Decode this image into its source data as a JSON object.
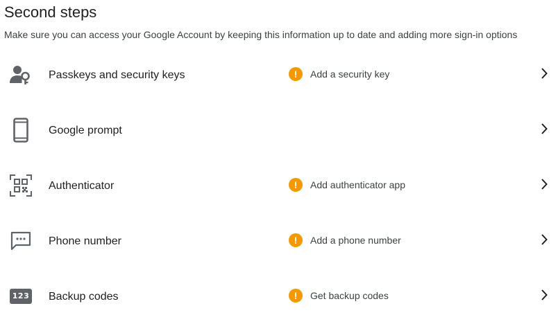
{
  "section": {
    "title": "Second steps",
    "subtitle": "Make sure you can access your Google Account by keeping this information up to date and adding more sign-in options"
  },
  "colors": {
    "warning": "#f29900",
    "icon": "#5f6368",
    "text": "#202124",
    "subtext": "#3c4043"
  },
  "rows": [
    {
      "label": "Passkeys and security keys",
      "icon": "passkey-icon",
      "status": "Add a security key",
      "warning": true
    },
    {
      "label": "Google prompt",
      "icon": "phone-device-icon",
      "status": "",
      "warning": false
    },
    {
      "label": "Authenticator",
      "icon": "qr-code-icon",
      "status": "Add authenticator app",
      "warning": true
    },
    {
      "label": "Phone number",
      "icon": "message-icon",
      "status": "Add a phone number",
      "warning": true
    },
    {
      "label": "Backup codes",
      "icon": "backup-codes-icon",
      "icon_text": "123",
      "status": "Get backup codes",
      "warning": true
    }
  ],
  "warning_glyph": "!"
}
